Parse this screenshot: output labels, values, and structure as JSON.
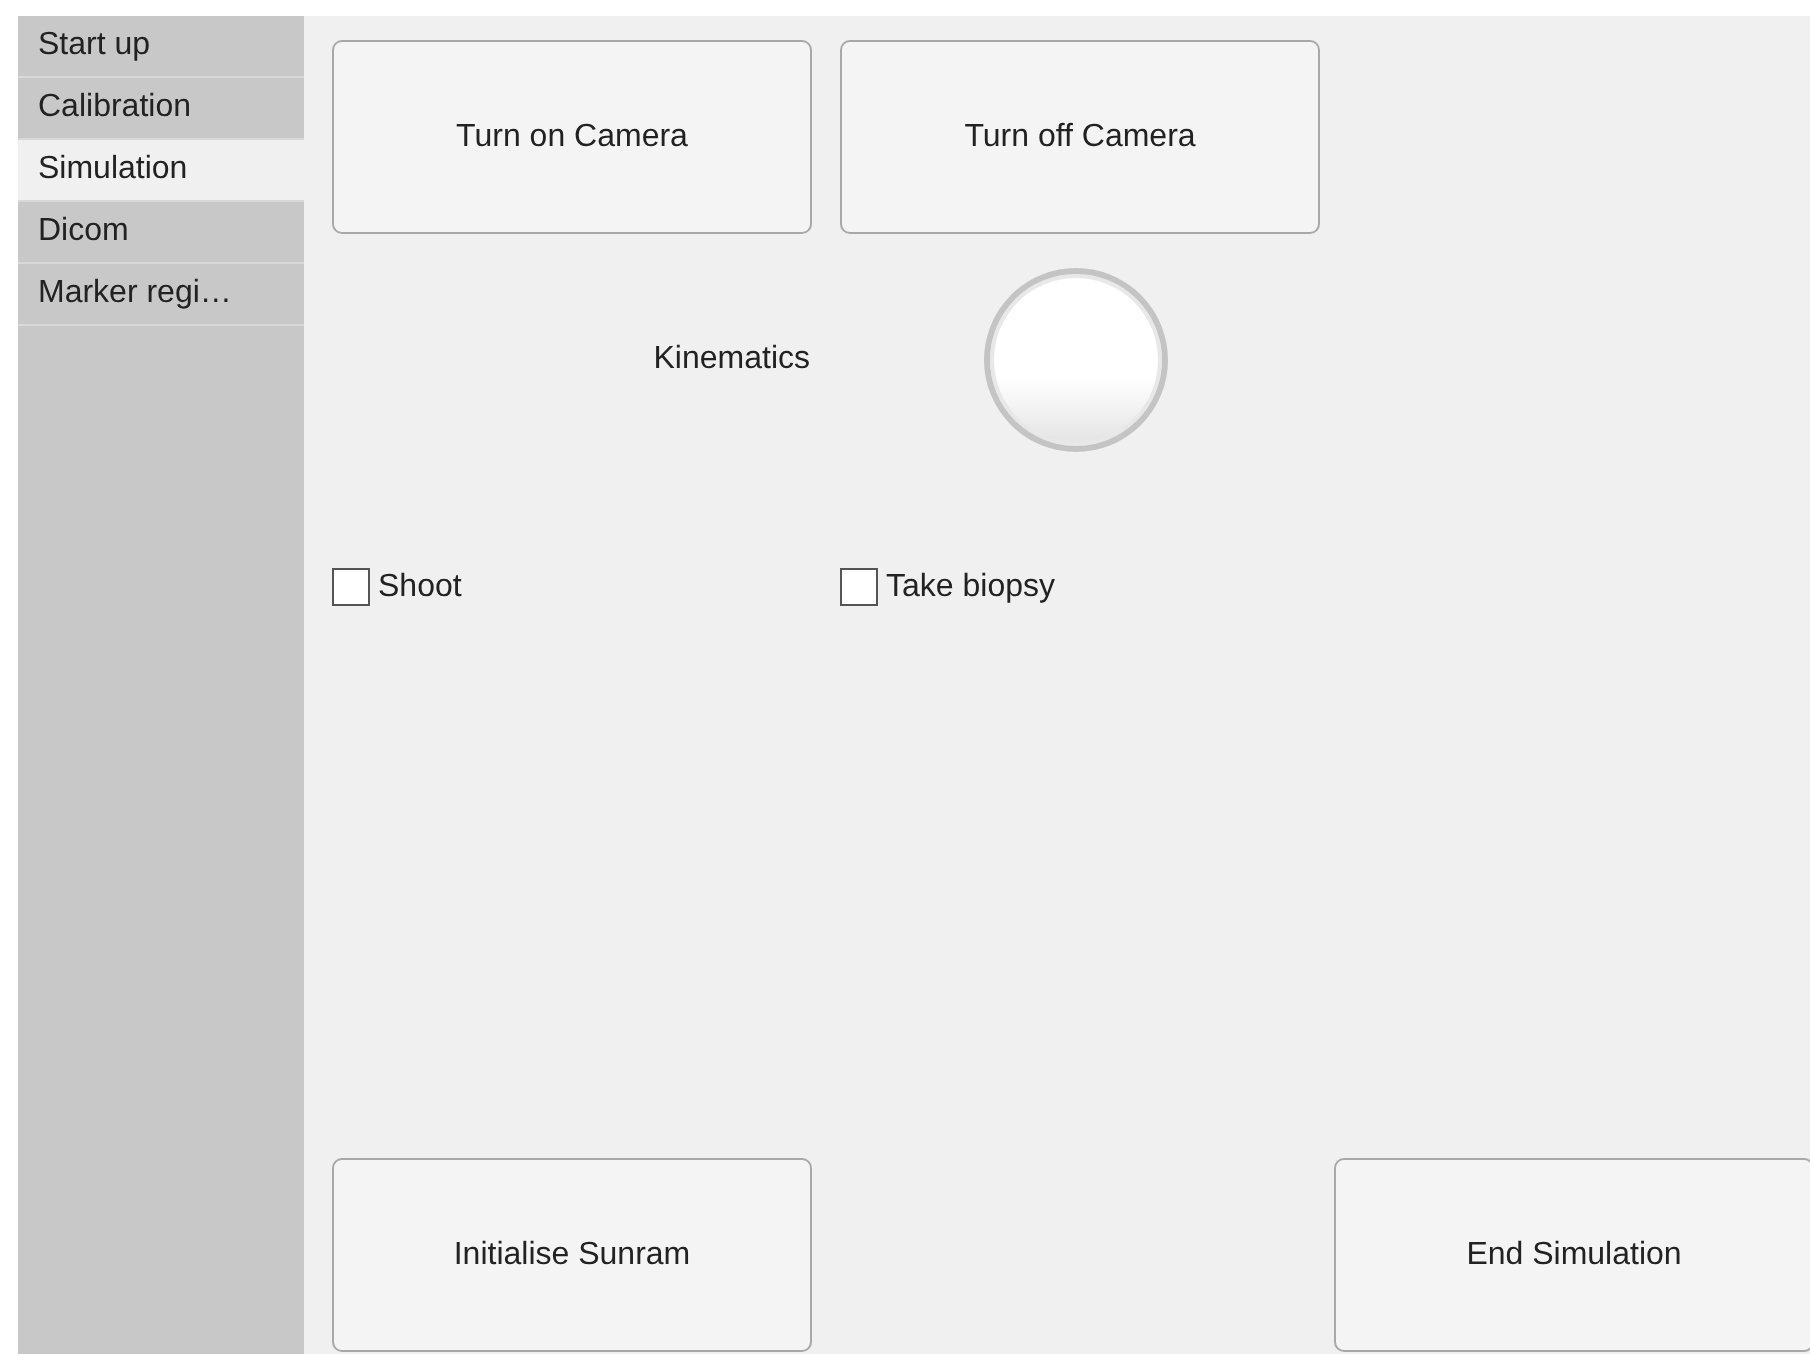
{
  "sidebar": {
    "items": [
      {
        "label": "Start up",
        "selected": false
      },
      {
        "label": "Calibration",
        "selected": false
      },
      {
        "label": "Simulation",
        "selected": true
      },
      {
        "label": "Dicom",
        "selected": false
      },
      {
        "label": "Marker regi…",
        "selected": false
      }
    ]
  },
  "camera_buttons": [
    "Turn on Camera",
    "Turn off Camera"
  ],
  "lamp": {
    "label": "Kinematics",
    "on": false
  },
  "checkboxes": [
    {
      "label": "Shoot",
      "checked": false
    },
    {
      "label": "Take biopsy",
      "checked": false
    }
  ],
  "bottom_buttons": [
    "Initialise Sunram",
    "End Simulation"
  ]
}
